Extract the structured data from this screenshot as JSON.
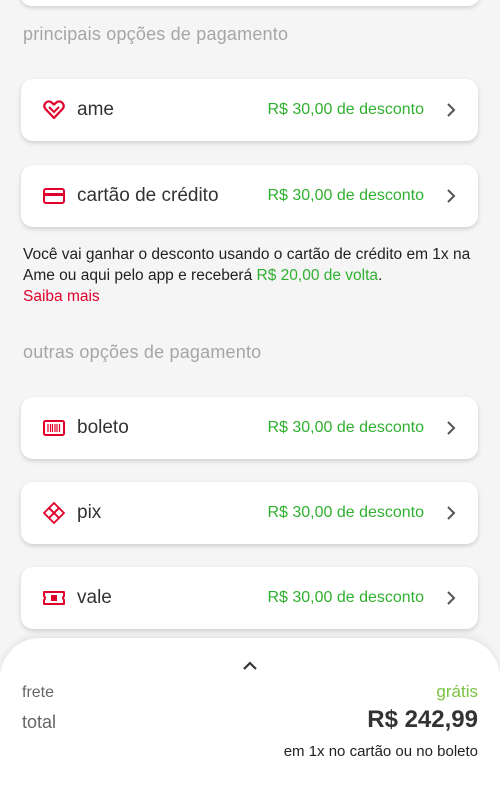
{
  "sections": {
    "main_title": "principais opções de pagamento",
    "other_title": "outras opções de pagamento"
  },
  "main_options": [
    {
      "label": "ame",
      "discount": "R$ 30,00 de desconto",
      "icon": "ame-heart-icon"
    },
    {
      "label": "cartão de crédito",
      "discount": "R$ 30,00 de desconto",
      "icon": "credit-card-icon"
    }
  ],
  "info": {
    "text_before": "Você vai ganhar o desconto usando o cartão de crédito em 1x na Ame ou aqui pelo app e receberá ",
    "cashback": "R$ 20,00 de volta",
    "text_after": ".",
    "link": "Saiba mais"
  },
  "other_options": [
    {
      "label": "boleto",
      "discount": "R$ 30,00 de desconto",
      "icon": "barcode-icon"
    },
    {
      "label": "pix",
      "discount": "R$ 30,00 de desconto",
      "icon": "pix-icon"
    },
    {
      "label": "vale",
      "discount": "R$ 30,00 de desconto",
      "icon": "voucher-icon"
    }
  ],
  "summary": {
    "frete_label": "frete",
    "frete_value": "grátis",
    "total_label": "total",
    "total_value": "R$ 242,99",
    "total_note": "em 1x no cartão ou no boleto"
  },
  "colors": {
    "brand_red": "#e0002b",
    "discount_green": "#30b030",
    "free_green": "#7cc242"
  }
}
